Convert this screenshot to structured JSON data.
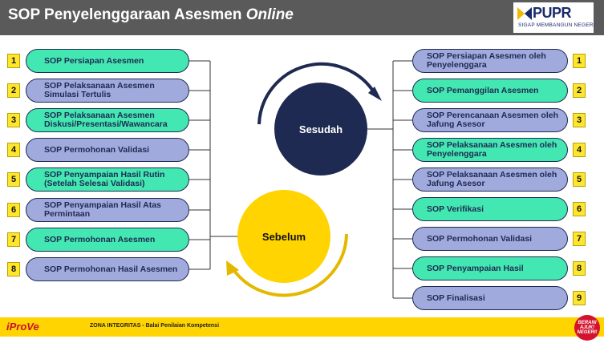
{
  "header": {
    "title_main": "SOP Penyelenggaraan Asesmen ",
    "title_italic": "Online"
  },
  "logo": {
    "name": "PUPR",
    "tagline": "SIGAP MEMBANGUN NEGERI"
  },
  "circles": {
    "after": "Sesudah",
    "before": "Sebelum"
  },
  "left_items": [
    {
      "num": "1",
      "label": "SOP Persiapan Asesmen",
      "color": "green"
    },
    {
      "num": "2",
      "label": "SOP Pelaksanaan Asesmen Simulasi Tertulis",
      "color": "blue"
    },
    {
      "num": "3",
      "label": "SOP Pelaksanaan Asesmen Diskusi/Presentasi/Wawancara",
      "color": "green"
    },
    {
      "num": "4",
      "label": "SOP Permohonan Validasi",
      "color": "blue"
    },
    {
      "num": "5",
      "label": "SOP Penyampaian Hasil Rutin (Setelah Selesai Validasi)",
      "color": "green"
    },
    {
      "num": "6",
      "label": "SOP Penyampaian Hasil Atas Permintaan",
      "color": "blue"
    },
    {
      "num": "7",
      "label": "SOP Permohonan Asesmen",
      "color": "green"
    },
    {
      "num": "8",
      "label": "SOP Permohonan Hasil Asesmen",
      "color": "blue"
    }
  ],
  "right_items": [
    {
      "num": "1",
      "label": "SOP Persiapan Asesmen oleh Penyelenggara",
      "color": "blue"
    },
    {
      "num": "2",
      "label": "SOP Pemanggilan Asesmen",
      "color": "green"
    },
    {
      "num": "3",
      "label": "SOP Perencanaan Asesmen oleh Jafung Asesor",
      "color": "blue"
    },
    {
      "num": "4",
      "label": "SOP Pelaksanaan Asesmen oleh Penyelenggara",
      "color": "green"
    },
    {
      "num": "5",
      "label": "SOP Pelaksanaan Asesmen oleh Jafung Asesor",
      "color": "blue"
    },
    {
      "num": "6",
      "label": "SOP Verifikasi",
      "color": "green"
    },
    {
      "num": "7",
      "label": "SOP Permohonan Validasi",
      "color": "blue"
    },
    {
      "num": "8",
      "label": "SOP Penyampaian Hasil",
      "color": "green"
    },
    {
      "num": "9",
      "label": "SOP Finalisasi",
      "color": "blue"
    }
  ],
  "footer": {
    "brand": "iProVe",
    "text": "ZONA INTEGRITAS - Balai Penilaian Kompetensi",
    "badge": "BERANI AJUK! NEGERI!"
  },
  "colors": {
    "header_bg": "#5a5a5a",
    "green": "#43e7b2",
    "blue": "#a1aadc",
    "navy": "#1f2a52",
    "yellow": "#ffd400"
  }
}
